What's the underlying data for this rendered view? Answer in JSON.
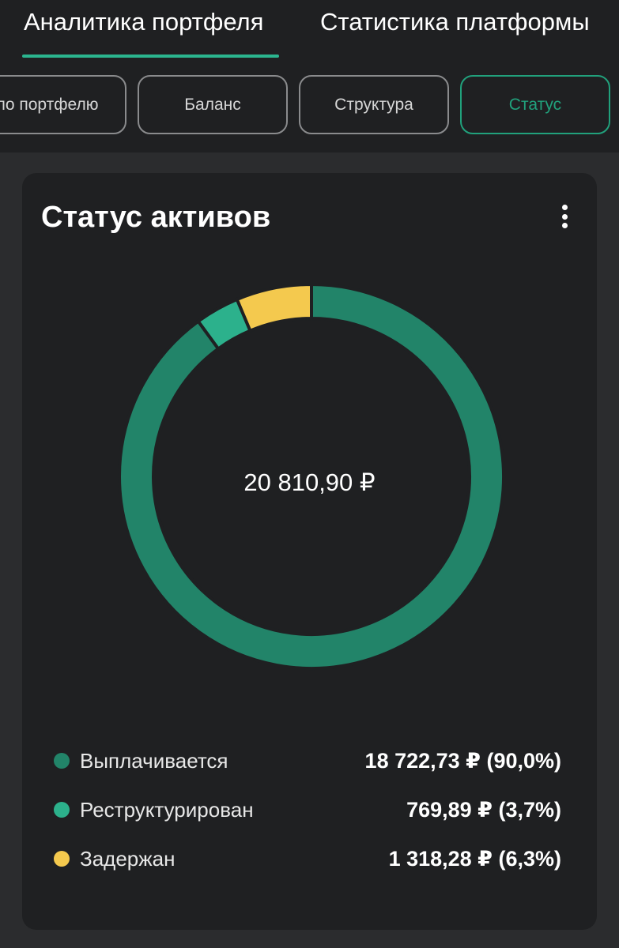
{
  "header": {
    "tabs": [
      {
        "label": "Аналитика портфеля",
        "active": true
      },
      {
        "label": "Статистика платформы",
        "active": false
      }
    ],
    "accent_color": "#2bb58f"
  },
  "subtabs": [
    {
      "label": "по портфелю"
    },
    {
      "label": "Баланс"
    },
    {
      "label": "Структура"
    },
    {
      "label": "Статус",
      "active": true
    }
  ],
  "card": {
    "title": "Статус активов",
    "menu_icon": "more-vertical-icon",
    "total": "20 810,90 ₽"
  },
  "chart_data": {
    "type": "pie",
    "donut": true,
    "center_label": "20 810,90 ₽",
    "slices": [
      {
        "name": "Выплачивается",
        "value": 18722.73,
        "value_label": "18 722,73 ₽ (90,0%)",
        "percent": 90.0,
        "color": "#228469"
      },
      {
        "name": "Реструктурирован",
        "value": 769.89,
        "value_label": "769,89 ₽ (3,7%)",
        "percent": 3.7,
        "color": "#2cb18c"
      },
      {
        "name": "Задержан",
        "value": 1318.28,
        "value_label": "1 318,28 ₽ (6,3%)",
        "percent": 6.3,
        "color": "#f4c94e"
      }
    ],
    "legend": "bottom"
  }
}
